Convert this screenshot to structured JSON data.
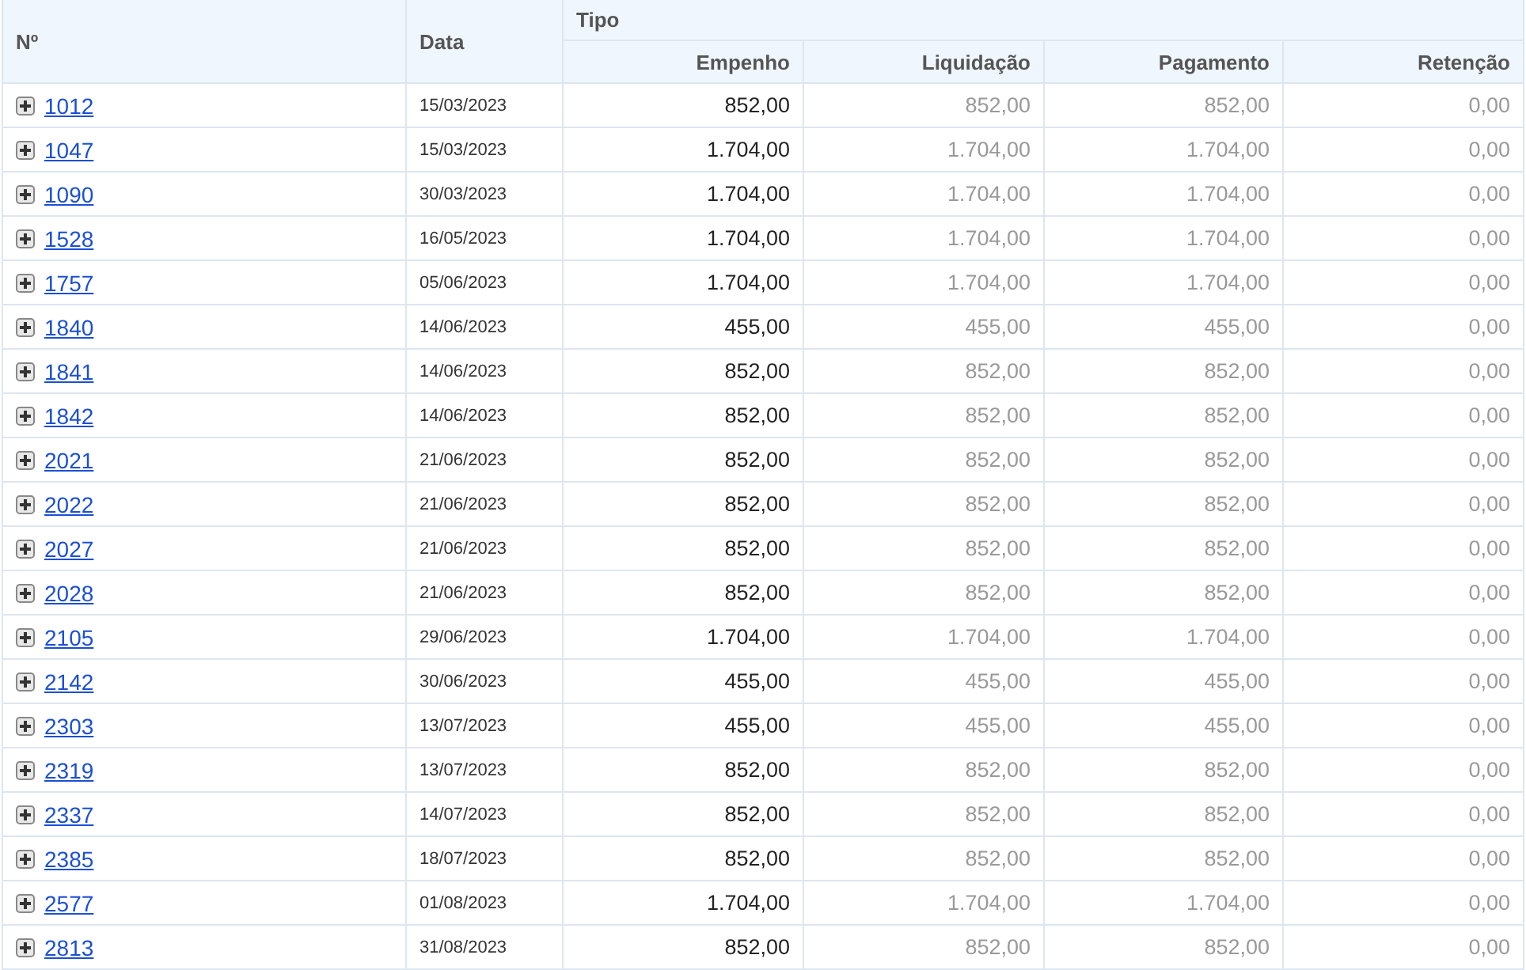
{
  "header": {
    "number": "Nº",
    "date": "Data",
    "group": "Tipo",
    "columns": [
      "Empenho",
      "Liquidação",
      "Pagamento",
      "Retenção"
    ]
  },
  "rows": [
    {
      "number": "1012",
      "expanded": false,
      "date": "15/03/2023",
      "values": [
        "852,00",
        "852,00",
        "852,00",
        "0,00"
      ]
    },
    {
      "number": "1047",
      "expanded": false,
      "date": "15/03/2023",
      "values": [
        "1.704,00",
        "1.704,00",
        "1.704,00",
        "0,00"
      ]
    },
    {
      "number": "1090",
      "expanded": false,
      "date": "30/03/2023",
      "values": [
        "1.704,00",
        "1.704,00",
        "1.704,00",
        "0,00"
      ]
    },
    {
      "number": "1528",
      "expanded": false,
      "date": "16/05/2023",
      "values": [
        "1.704,00",
        "1.704,00",
        "1.704,00",
        "0,00"
      ]
    },
    {
      "number": "1757",
      "expanded": false,
      "date": "05/06/2023",
      "values": [
        "1.704,00",
        "1.704,00",
        "1.704,00",
        "0,00"
      ]
    },
    {
      "number": "1840",
      "expanded": false,
      "date": "14/06/2023",
      "values": [
        "455,00",
        "455,00",
        "455,00",
        "0,00"
      ]
    },
    {
      "number": "1841",
      "expanded": false,
      "date": "14/06/2023",
      "values": [
        "852,00",
        "852,00",
        "852,00",
        "0,00"
      ]
    },
    {
      "number": "1842",
      "expanded": false,
      "date": "14/06/2023",
      "values": [
        "852,00",
        "852,00",
        "852,00",
        "0,00"
      ]
    },
    {
      "number": "2021",
      "expanded": false,
      "date": "21/06/2023",
      "values": [
        "852,00",
        "852,00",
        "852,00",
        "0,00"
      ]
    },
    {
      "number": "2022",
      "expanded": false,
      "date": "21/06/2023",
      "values": [
        "852,00",
        "852,00",
        "852,00",
        "0,00"
      ]
    },
    {
      "number": "2027",
      "expanded": false,
      "date": "21/06/2023",
      "values": [
        "852,00",
        "852,00",
        "852,00",
        "0,00"
      ]
    },
    {
      "number": "2028",
      "expanded": false,
      "date": "21/06/2023",
      "values": [
        "852,00",
        "852,00",
        "852,00",
        "0,00"
      ]
    },
    {
      "number": "2105",
      "expanded": false,
      "date": "29/06/2023",
      "values": [
        "1.704,00",
        "1.704,00",
        "1.704,00",
        "0,00"
      ]
    },
    {
      "number": "2142",
      "expanded": false,
      "date": "30/06/2023",
      "values": [
        "455,00",
        "455,00",
        "455,00",
        "0,00"
      ]
    },
    {
      "number": "2303",
      "expanded": false,
      "date": "13/07/2023",
      "values": [
        "455,00",
        "455,00",
        "455,00",
        "0,00"
      ]
    },
    {
      "number": "2319",
      "expanded": false,
      "date": "13/07/2023",
      "values": [
        "852,00",
        "852,00",
        "852,00",
        "0,00"
      ]
    },
    {
      "number": "2337",
      "expanded": false,
      "date": "14/07/2023",
      "values": [
        "852,00",
        "852,00",
        "852,00",
        "0,00"
      ]
    },
    {
      "number": "2385",
      "expanded": false,
      "date": "18/07/2023",
      "values": [
        "852,00",
        "852,00",
        "852,00",
        "0,00"
      ]
    },
    {
      "number": "2577",
      "expanded": false,
      "date": "01/08/2023",
      "values": [
        "1.704,00",
        "1.704,00",
        "1.704,00",
        "0,00"
      ]
    },
    {
      "number": "2813",
      "expanded": false,
      "date": "31/08/2023",
      "values": [
        "852,00",
        "852,00",
        "852,00",
        "0,00"
      ]
    }
  ]
}
